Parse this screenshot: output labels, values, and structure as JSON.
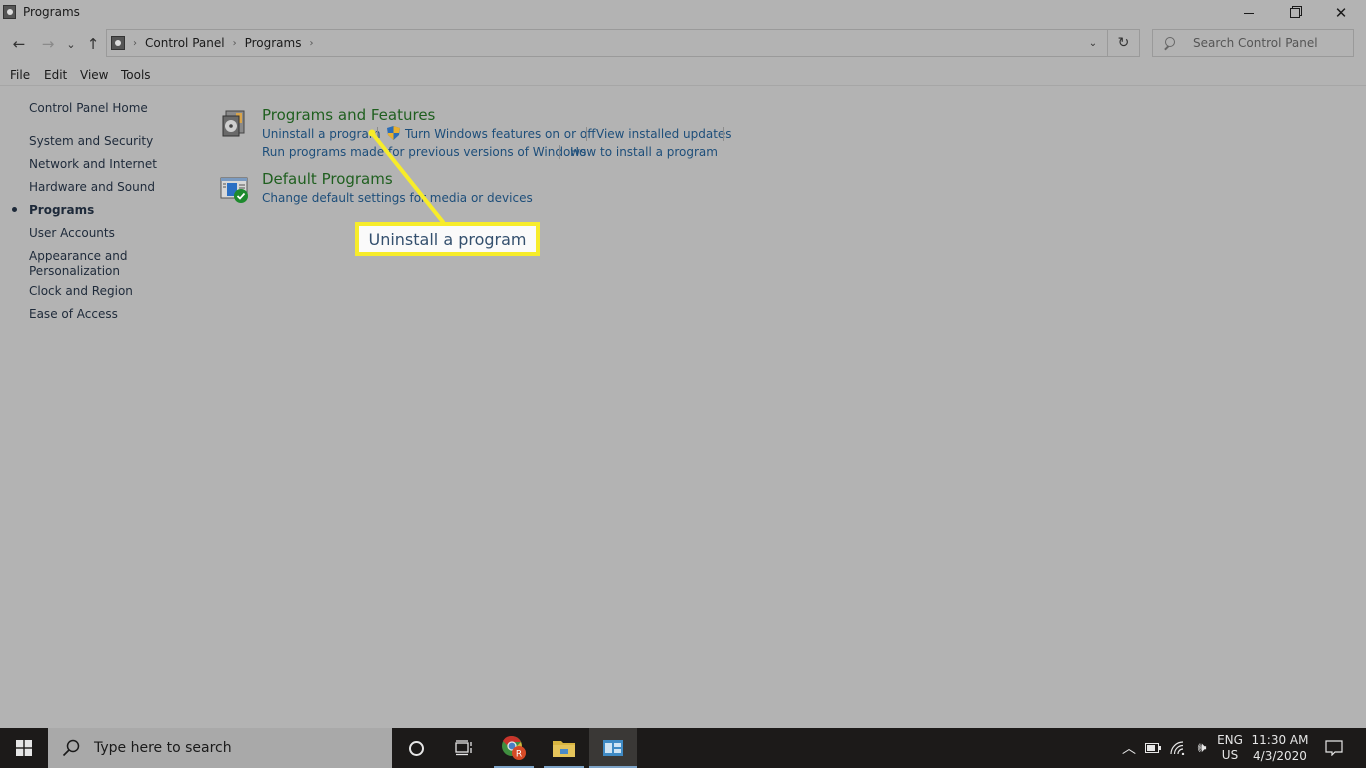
{
  "window": {
    "title": "Programs",
    "minimize_icon": "minimize-icon",
    "maximize_icon": "restore-icon",
    "close_icon": "close-icon"
  },
  "navigation": {
    "back": "←",
    "forward": "→",
    "recent": "⌄",
    "up": "↑",
    "breadcrumb": [
      "Control Panel",
      "Programs"
    ],
    "refresh": "↻",
    "search_placeholder": "Search Control Panel"
  },
  "menu": [
    "File",
    "Edit",
    "View",
    "Tools"
  ],
  "sidebar": {
    "home": "Control Panel Home",
    "items": [
      {
        "label": "System and Security",
        "active": false
      },
      {
        "label": "Network and Internet",
        "active": false
      },
      {
        "label": "Hardware and Sound",
        "active": false
      },
      {
        "label": "Programs",
        "active": true
      },
      {
        "label": "User Accounts",
        "active": false
      },
      {
        "label": "Appearance and\nPersonalization",
        "active": false
      },
      {
        "label": "Clock and Region",
        "active": false
      },
      {
        "label": "Ease of Access",
        "active": false
      }
    ]
  },
  "categories": [
    {
      "title": "Programs and Features",
      "icon": "programs-features-icon",
      "links_row1": [
        "Uninstall a program",
        "Turn Windows features on or off",
        "View installed updates"
      ],
      "links_row2": [
        "Run programs made for previous versions of Windows",
        "How to install a program"
      ]
    },
    {
      "title": "Default Programs",
      "icon": "default-programs-icon",
      "links_row1": [
        "Change default settings for media or devices"
      ]
    }
  ],
  "callout": {
    "text": "Uninstall a program",
    "color": "#f7ec2a"
  },
  "taskbar": {
    "search_placeholder": "Type here to search",
    "apps": [
      "cortana",
      "task-view",
      "chrome",
      "file-explorer",
      "control-panel"
    ],
    "language_line1": "ENG",
    "language_line2": "US",
    "time": "11:30 AM",
    "date": "4/3/2020"
  }
}
